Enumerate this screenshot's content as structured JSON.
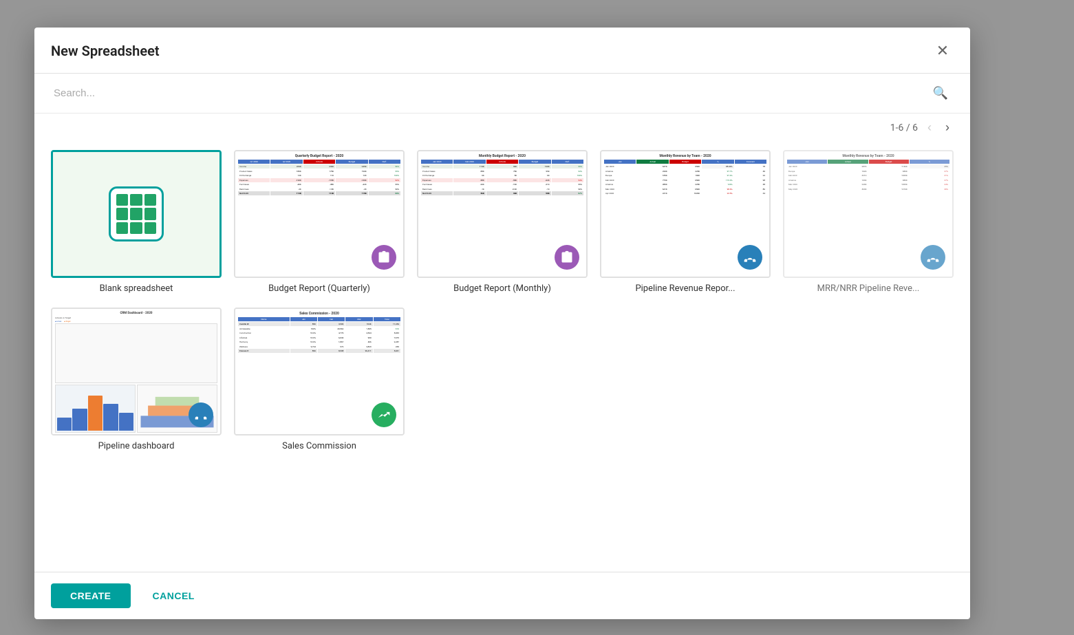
{
  "modal": {
    "title": "New Spreadsheet",
    "close_label": "×"
  },
  "search": {
    "placeholder": "Search..."
  },
  "pagination": {
    "label": "1-6 / 6",
    "prev_disabled": true,
    "next_disabled": false
  },
  "footer": {
    "create_label": "CREATE",
    "cancel_label": "CANCEL"
  },
  "templates": [
    {
      "id": "blank",
      "label": "Blank spreadsheet",
      "selected": true,
      "type": "blank"
    },
    {
      "id": "budget-quarterly",
      "label": "Budget Report (Quarterly)",
      "selected": false,
      "type": "spreadsheet",
      "has_badge": true,
      "badge_color": "purple"
    },
    {
      "id": "budget-monthly",
      "label": "Budget Report (Monthly)",
      "selected": false,
      "type": "spreadsheet",
      "has_badge": true,
      "badge_color": "purple"
    },
    {
      "id": "pipeline-revenue",
      "label": "Pipeline Revenue Repor...",
      "selected": false,
      "type": "spreadsheet",
      "has_badge": true,
      "badge_color": "blue"
    },
    {
      "id": "mrr-nrr",
      "label": "MRR/NRR Pipeline Reve...",
      "selected": false,
      "type": "spreadsheet",
      "has_badge": true,
      "badge_color": "blue",
      "partial": true
    },
    {
      "id": "pipeline-dashboard",
      "label": "Pipeline dashboard",
      "selected": false,
      "type": "dashboard",
      "has_badge": true,
      "badge_color": "blue"
    },
    {
      "id": "sales-commission",
      "label": "Sales Commission",
      "selected": false,
      "type": "spreadsheet2",
      "has_badge": true,
      "badge_color": "green"
    }
  ]
}
